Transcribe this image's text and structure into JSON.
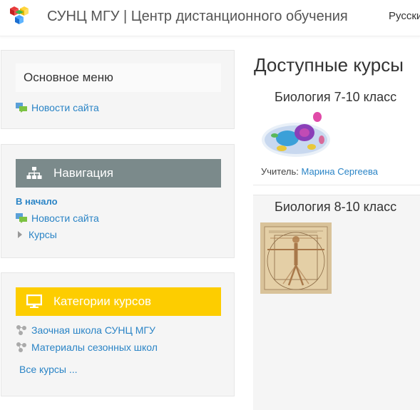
{
  "header": {
    "site_title": "СУНЦ МГУ | Центр дистанционного обучения",
    "language": "Русский"
  },
  "main_menu": {
    "title": "Основное меню",
    "items": [
      {
        "label": "Новости сайта"
      }
    ]
  },
  "navigation": {
    "title": "Навигация",
    "home": "В начало",
    "items": [
      {
        "label": "Новости сайта"
      },
      {
        "label": "Курсы"
      }
    ]
  },
  "categories": {
    "title": "Категории курсов",
    "items": [
      {
        "label": "Заочная школа СУНЦ МГУ"
      },
      {
        "label": "Материалы сезонных школ"
      }
    ],
    "all_courses": "Все курсы ..."
  },
  "content": {
    "heading": "Доступные курсы",
    "courses": [
      {
        "name": "Биология 7-10 класс",
        "teacher_label": "Учитель:",
        "teacher": "Марина Сергеева"
      },
      {
        "name": "Биология 8-10 класс"
      }
    ]
  },
  "colors": {
    "link": "#2a84c6",
    "nav_bar": "#7b8a8b",
    "category_bar": "#fdcd00",
    "block_bg": "#f5f5f5"
  },
  "icons": [
    "cubes-logo-icon",
    "news-icon",
    "sitemap-icon",
    "monitor-icon",
    "triangle-right-icon",
    "category-icon"
  ]
}
